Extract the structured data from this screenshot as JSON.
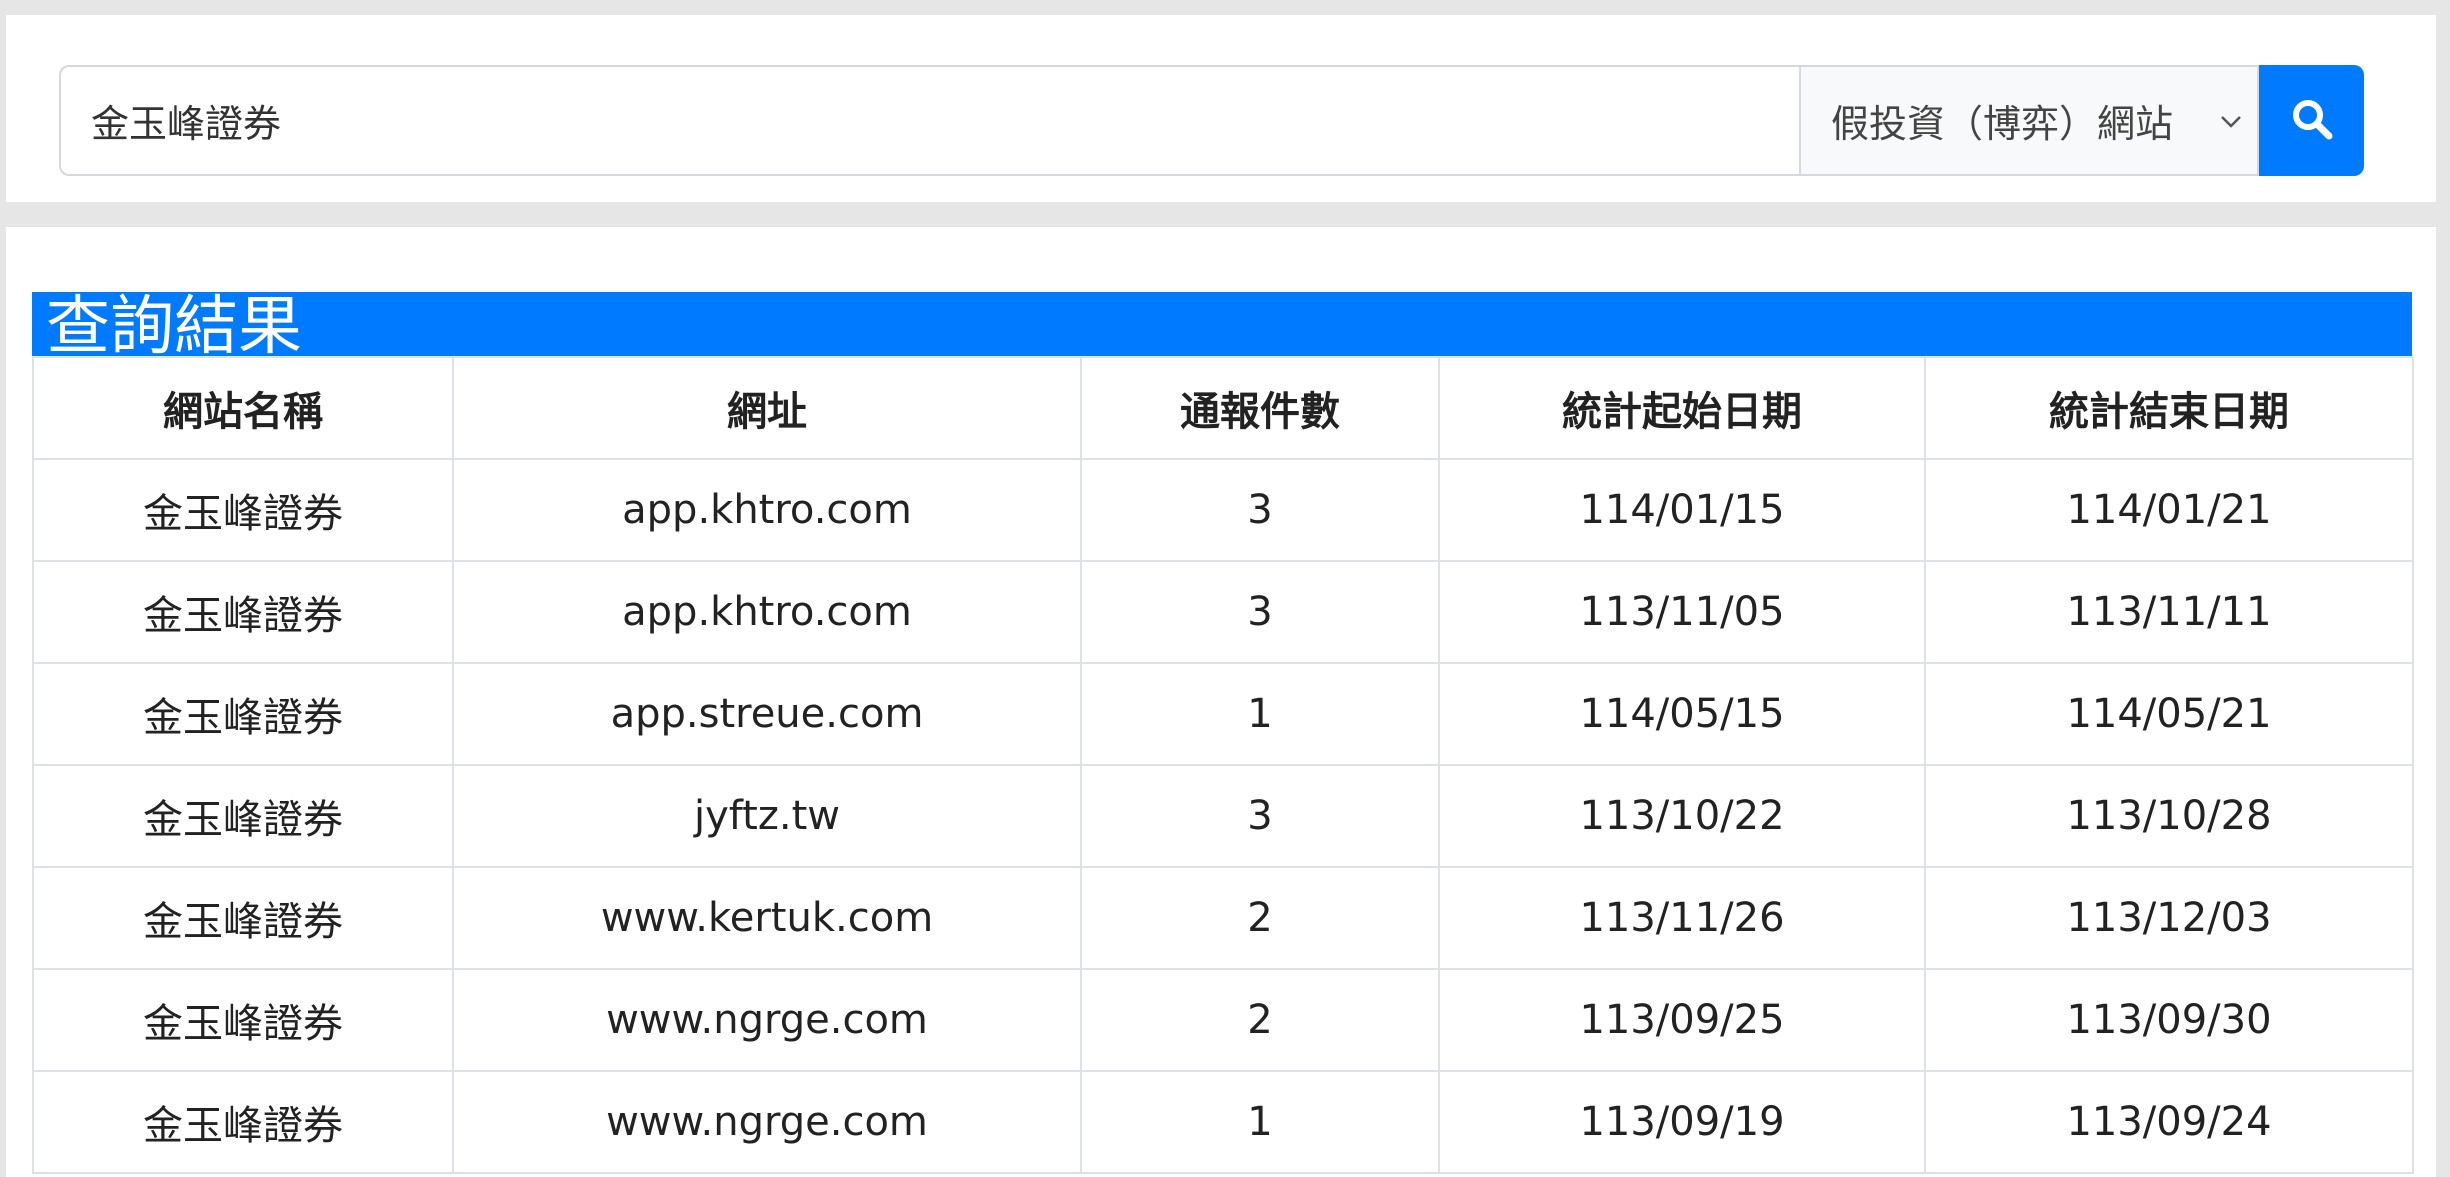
{
  "search": {
    "query": "金玉峰證券",
    "category": "假投資（博弈）網站",
    "icons": {
      "search": "search-icon",
      "dropdown": "chevron-down-icon"
    },
    "accent_color": "#007bff"
  },
  "results": {
    "title": "查詢結果",
    "columns": [
      "網站名稱",
      "網址",
      "通報件數",
      "統計起始日期",
      "統計結束日期"
    ],
    "rows": [
      [
        "金玉峰證券",
        "app.khtro.com",
        "3",
        "114/01/15",
        "114/01/21"
      ],
      [
        "金玉峰證券",
        "app.khtro.com",
        "3",
        "113/11/05",
        "113/11/11"
      ],
      [
        "金玉峰證券",
        "app.streue.com",
        "1",
        "114/05/15",
        "114/05/21"
      ],
      [
        "金玉峰證券",
        "jyftz.tw",
        "3",
        "113/10/22",
        "113/10/28"
      ],
      [
        "金玉峰證券",
        "www.kertuk.com",
        "2",
        "113/11/26",
        "113/12/03"
      ],
      [
        "金玉峰證券",
        "www.ngrge.com",
        "2",
        "113/09/25",
        "113/09/30"
      ],
      [
        "金玉峰證券",
        "www.ngrge.com",
        "1",
        "113/09/19",
        "113/09/24"
      ]
    ]
  }
}
